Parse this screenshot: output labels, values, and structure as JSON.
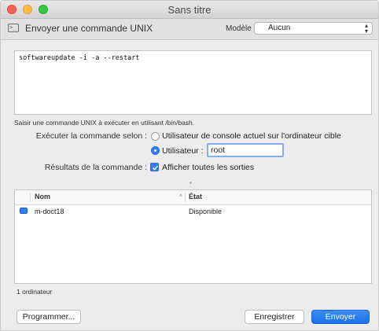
{
  "window": {
    "title": "Sans titre"
  },
  "toolbar": {
    "icon": "terminal-icon",
    "icon_glyph": ">_",
    "title": "Envoyer une commande UNIX",
    "model_label": "Modèle :",
    "model_value": "Aucun"
  },
  "command": {
    "text": "softwareupdate -i -a --restart",
    "hint": "Saisir une commande UNIX à exécuter en utilisant /bin/bash."
  },
  "run_as": {
    "label": "Exécuter la commande selon :",
    "option_console": "Utilisateur de console actuel sur l'ordinateur cible",
    "option_user": "Utilisateur :",
    "selected": "option_user",
    "user_value": "root"
  },
  "results": {
    "label": "Résultats de la commande :",
    "checkbox_label": "Afficher toutes les sorties",
    "checked": true
  },
  "table": {
    "columns": [
      "Nom",
      "État"
    ],
    "rows": [
      {
        "name": "m-doct18",
        "status": "Disponible",
        "icon": "computer-icon"
      }
    ]
  },
  "footer": {
    "count": "1 ordinateur",
    "schedule_label": "Programmer...",
    "save_label": "Enregistrer",
    "send_label": "Envoyer"
  },
  "colors": {
    "accent": "#2d7ff3",
    "close": "#fc605c",
    "minimize": "#fdbc40",
    "zoom": "#34c84a"
  }
}
